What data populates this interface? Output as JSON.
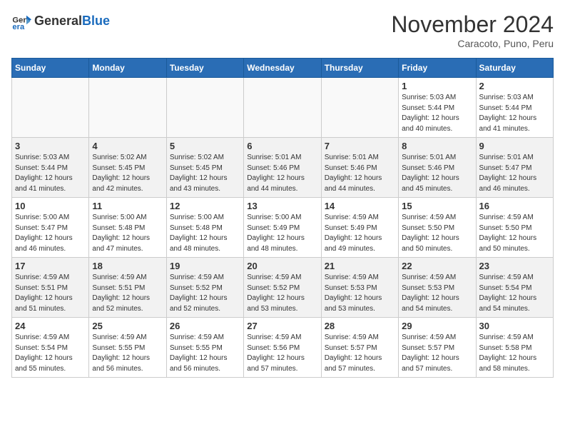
{
  "header": {
    "logo_general": "General",
    "logo_blue": "Blue",
    "month_title": "November 2024",
    "location": "Caracoto, Puno, Peru"
  },
  "weekdays": [
    "Sunday",
    "Monday",
    "Tuesday",
    "Wednesday",
    "Thursday",
    "Friday",
    "Saturday"
  ],
  "weeks": [
    [
      {
        "day": "",
        "sunrise": "",
        "sunset": "",
        "daylight": ""
      },
      {
        "day": "",
        "sunrise": "",
        "sunset": "",
        "daylight": ""
      },
      {
        "day": "",
        "sunrise": "",
        "sunset": "",
        "daylight": ""
      },
      {
        "day": "",
        "sunrise": "",
        "sunset": "",
        "daylight": ""
      },
      {
        "day": "",
        "sunrise": "",
        "sunset": "",
        "daylight": ""
      },
      {
        "day": "1",
        "sunrise": "5:03 AM",
        "sunset": "5:44 PM",
        "daylight": "12 hours and 40 minutes."
      },
      {
        "day": "2",
        "sunrise": "5:03 AM",
        "sunset": "5:44 PM",
        "daylight": "12 hours and 41 minutes."
      }
    ],
    [
      {
        "day": "3",
        "sunrise": "5:03 AM",
        "sunset": "5:44 PM",
        "daylight": "12 hours and 41 minutes."
      },
      {
        "day": "4",
        "sunrise": "5:02 AM",
        "sunset": "5:45 PM",
        "daylight": "12 hours and 42 minutes."
      },
      {
        "day": "5",
        "sunrise": "5:02 AM",
        "sunset": "5:45 PM",
        "daylight": "12 hours and 43 minutes."
      },
      {
        "day": "6",
        "sunrise": "5:01 AM",
        "sunset": "5:46 PM",
        "daylight": "12 hours and 44 minutes."
      },
      {
        "day": "7",
        "sunrise": "5:01 AM",
        "sunset": "5:46 PM",
        "daylight": "12 hours and 44 minutes."
      },
      {
        "day": "8",
        "sunrise": "5:01 AM",
        "sunset": "5:46 PM",
        "daylight": "12 hours and 45 minutes."
      },
      {
        "day": "9",
        "sunrise": "5:01 AM",
        "sunset": "5:47 PM",
        "daylight": "12 hours and 46 minutes."
      }
    ],
    [
      {
        "day": "10",
        "sunrise": "5:00 AM",
        "sunset": "5:47 PM",
        "daylight": "12 hours and 46 minutes."
      },
      {
        "day": "11",
        "sunrise": "5:00 AM",
        "sunset": "5:48 PM",
        "daylight": "12 hours and 47 minutes."
      },
      {
        "day": "12",
        "sunrise": "5:00 AM",
        "sunset": "5:48 PM",
        "daylight": "12 hours and 48 minutes."
      },
      {
        "day": "13",
        "sunrise": "5:00 AM",
        "sunset": "5:49 PM",
        "daylight": "12 hours and 48 minutes."
      },
      {
        "day": "14",
        "sunrise": "4:59 AM",
        "sunset": "5:49 PM",
        "daylight": "12 hours and 49 minutes."
      },
      {
        "day": "15",
        "sunrise": "4:59 AM",
        "sunset": "5:50 PM",
        "daylight": "12 hours and 50 minutes."
      },
      {
        "day": "16",
        "sunrise": "4:59 AM",
        "sunset": "5:50 PM",
        "daylight": "12 hours and 50 minutes."
      }
    ],
    [
      {
        "day": "17",
        "sunrise": "4:59 AM",
        "sunset": "5:51 PM",
        "daylight": "12 hours and 51 minutes."
      },
      {
        "day": "18",
        "sunrise": "4:59 AM",
        "sunset": "5:51 PM",
        "daylight": "12 hours and 52 minutes."
      },
      {
        "day": "19",
        "sunrise": "4:59 AM",
        "sunset": "5:52 PM",
        "daylight": "12 hours and 52 minutes."
      },
      {
        "day": "20",
        "sunrise": "4:59 AM",
        "sunset": "5:52 PM",
        "daylight": "12 hours and 53 minutes."
      },
      {
        "day": "21",
        "sunrise": "4:59 AM",
        "sunset": "5:53 PM",
        "daylight": "12 hours and 53 minutes."
      },
      {
        "day": "22",
        "sunrise": "4:59 AM",
        "sunset": "5:53 PM",
        "daylight": "12 hours and 54 minutes."
      },
      {
        "day": "23",
        "sunrise": "4:59 AM",
        "sunset": "5:54 PM",
        "daylight": "12 hours and 54 minutes."
      }
    ],
    [
      {
        "day": "24",
        "sunrise": "4:59 AM",
        "sunset": "5:54 PM",
        "daylight": "12 hours and 55 minutes."
      },
      {
        "day": "25",
        "sunrise": "4:59 AM",
        "sunset": "5:55 PM",
        "daylight": "12 hours and 56 minutes."
      },
      {
        "day": "26",
        "sunrise": "4:59 AM",
        "sunset": "5:55 PM",
        "daylight": "12 hours and 56 minutes."
      },
      {
        "day": "27",
        "sunrise": "4:59 AM",
        "sunset": "5:56 PM",
        "daylight": "12 hours and 57 minutes."
      },
      {
        "day": "28",
        "sunrise": "4:59 AM",
        "sunset": "5:57 PM",
        "daylight": "12 hours and 57 minutes."
      },
      {
        "day": "29",
        "sunrise": "4:59 AM",
        "sunset": "5:57 PM",
        "daylight": "12 hours and 57 minutes."
      },
      {
        "day": "30",
        "sunrise": "4:59 AM",
        "sunset": "5:58 PM",
        "daylight": "12 hours and 58 minutes."
      }
    ]
  ]
}
